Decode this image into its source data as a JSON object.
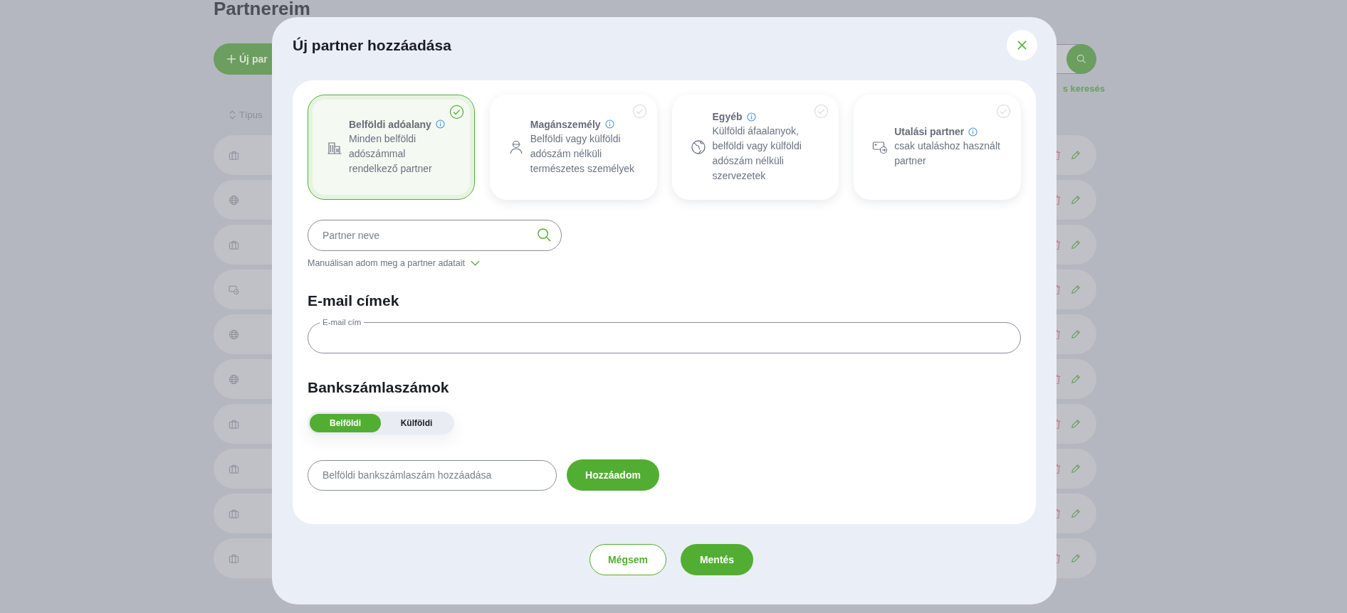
{
  "background": {
    "title": "Partnereim",
    "new_button": "Új par",
    "sort_label": "Típus",
    "search_link": "s keresés",
    "rows": [
      {
        "kind": "company"
      },
      {
        "kind": "foreign"
      },
      {
        "kind": "company"
      },
      {
        "kind": "transfer"
      },
      {
        "kind": "foreign"
      },
      {
        "kind": "foreign"
      },
      {
        "kind": "company"
      },
      {
        "kind": "company"
      },
      {
        "kind": "company"
      },
      {
        "kind": "company"
      }
    ]
  },
  "modal": {
    "title": "Új partner hozzáadása",
    "types": [
      {
        "kind": "building",
        "title": "Belföldi adóalany",
        "description": "Minden belföldi adószámmal rendelkező partner",
        "selected": true
      },
      {
        "kind": "person",
        "title": "Magánszemély",
        "description": "Belföldi vagy külföldi adószám nélküli természetes személyek",
        "selected": false
      },
      {
        "kind": "globe",
        "title": "Egyéb",
        "description": "Külföldi áfaalanyok, belföldi vagy külföldi adószám nélküli szervezetek",
        "selected": false
      },
      {
        "kind": "transfer",
        "title": "Utalási partner",
        "description": "csak utaláshoz használt partner",
        "selected": false
      }
    ],
    "partner_search": {
      "placeholder": "Partner neve"
    },
    "manual_link": "Manuálisan adom meg a partner adatait",
    "email_heading": "E-mail címek",
    "email_field": {
      "label": "E-mail cím"
    },
    "bank_heading": "Bankszámlaszámok",
    "bank_tabs": [
      {
        "label": "Belföldi",
        "selected": true
      },
      {
        "label": "Külföldi",
        "selected": false
      }
    ],
    "bank_field": {
      "placeholder": "Belföldi bankszámlaszám hozzáadása"
    },
    "add_button": "Hozzáadom",
    "cancel_button": "Mégsem",
    "save_button": "Mentés"
  }
}
